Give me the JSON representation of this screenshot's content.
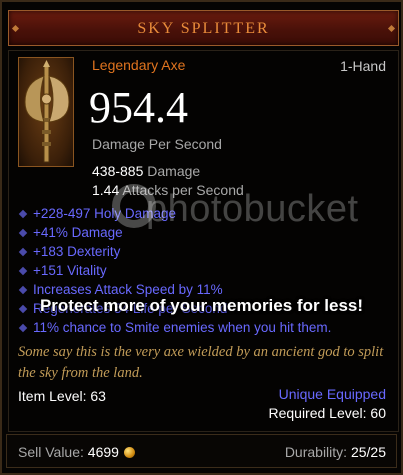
{
  "item": {
    "name": "SKY SPLITTER",
    "type": "Legendary Axe",
    "hand": "1-Hand",
    "dps": "954.4",
    "dps_label": "Damage Per Second",
    "damage_value": "438-885",
    "damage_label": "Damage",
    "aps_value": "1.44",
    "aps_label": "Attacks per Second",
    "icon": "axe-icon"
  },
  "properties": [
    "+228-497 Holy Damage",
    "+41% Damage",
    "+183 Dexterity",
    "+151 Vitality",
    "Increases Attack Speed by 11%",
    "Regenerates 54 Life per Second",
    "11% chance to Smite enemies when you hit them."
  ],
  "flavor_text": "Some say this is the very axe wielded by an ancient god to split the sky from the land.",
  "item_level": {
    "label": "Item Level:",
    "value": "63"
  },
  "unique_equipped": "Unique Equipped",
  "required_level": {
    "label": "Required Level:",
    "value": "60"
  },
  "sell_value": {
    "label": "Sell Value:",
    "value": "4699",
    "icon": "gold-coin-icon"
  },
  "durability": {
    "label": "Durability:",
    "value": "25/25"
  },
  "watermark": {
    "brand": "photobucket",
    "promo": "Protect more of your memories for less!"
  },
  "colors": {
    "legendary": "#e0741f",
    "magic": "#6969ff",
    "flavor": "#c29c58",
    "title": "#e88b3a"
  }
}
